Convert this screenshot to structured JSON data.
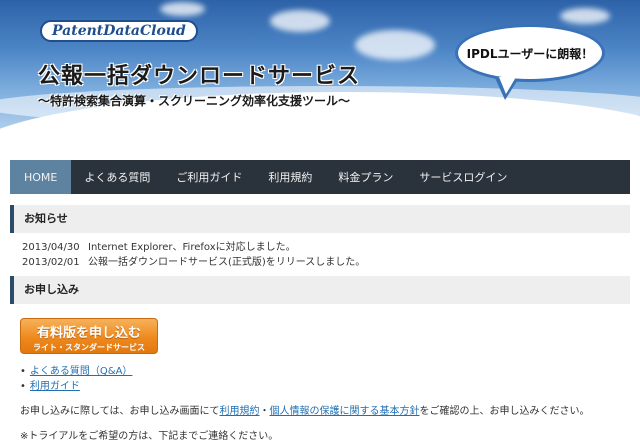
{
  "header": {
    "logo": "PatentDataCloud",
    "title": "公報一括ダウンロードサービス",
    "subtitle": "～特許検索集合演算・スクリーニング効率化支援ツール～",
    "bubble": "IPDLユーザーに朗報！"
  },
  "nav": {
    "items": [
      {
        "label": "HOME"
      },
      {
        "label": "よくある質問"
      },
      {
        "label": "ご利用ガイド"
      },
      {
        "label": "利用規約"
      },
      {
        "label": "料金プラン"
      },
      {
        "label": "サービスログイン"
      }
    ]
  },
  "news": {
    "heading": "お知らせ",
    "items": [
      {
        "date": "2013/04/30",
        "text": "Internet Explorer、Firefoxに対応しました。"
      },
      {
        "date": "2013/02/01",
        "text": "公報一括ダウンロードサービス(正式版)をリリースしました。"
      }
    ]
  },
  "apply": {
    "heading": "お申し込み",
    "button_main": "有料版を申し込む",
    "button_sub": "ライト・スタンダードサービス",
    "links": [
      "よくある質問（Q&A）",
      "利用ガイド"
    ],
    "note_prefix": "お申し込みに際しては、お申し込み画面にて",
    "note_link1": "利用規約",
    "note_sep": "・",
    "note_link2": "個人情報の保護に関する基本方針",
    "note_suffix": "をご確認の上、お申し込みください。",
    "trial_note": "※トライアルをご希望の方は、下記までご連絡ください。"
  },
  "colors": {
    "nav_bg": "#2a323b",
    "nav_active": "#5d83a1",
    "button_orange": "#ee8a1d",
    "link": "#1f6fb2"
  }
}
